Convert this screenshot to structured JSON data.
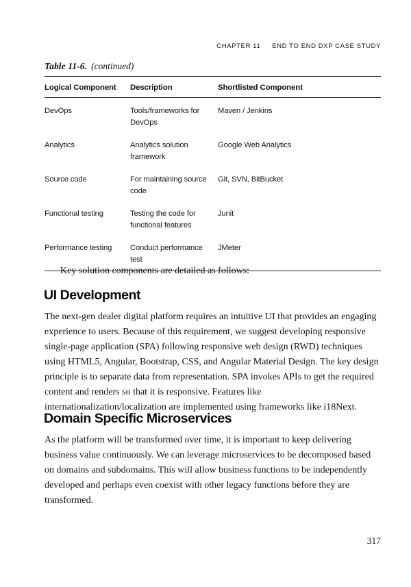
{
  "running_head": {
    "chapter": "CHAPTER 11",
    "title": "END TO END DXP CASE STUDY"
  },
  "table": {
    "caption_number": "Table 11-6.",
    "caption_note": "(continued)",
    "columns": [
      "Logical Component",
      "Description",
      "Shortlisted Component"
    ],
    "rows": [
      {
        "logical_component": "DevOps",
        "description": "Tools/frameworks for DevOps",
        "shortlisted_component": "Maven / Jenkins"
      },
      {
        "logical_component": "Analytics",
        "description": "Analytics solution framework",
        "shortlisted_component": "Google Web Analytics"
      },
      {
        "logical_component": "Source code",
        "description": "For maintaining source code",
        "shortlisted_component": "Git, SVN, BitBucket"
      },
      {
        "logical_component": "Functional testing",
        "description": "Testing the code for functional features",
        "shortlisted_component": "Junit"
      },
      {
        "logical_component": "Performance testing",
        "description": "Conduct performance test",
        "shortlisted_component": "JMeter"
      }
    ]
  },
  "content": {
    "lead_paragraph": "Key solution components are detailed as follows:",
    "section_ui_heading": "UI Development",
    "section_ui_body": "The next-gen dealer digital platform requires an intuitive UI that provides an engaging experience to users. Because of this requirement, we suggest developing responsive single-page application (SPA) following responsive web design (RWD) techniques using HTML5, Angular, Bootstrap, CSS, and Angular Material Design. The key design principle is to separate data from representation. SPA invokes APIs to get the required content and renders so that it is responsive. Features like internationalization/localization are implemented using frameworks like i18Next.",
    "section_microservices_heading": "Domain Specific Microservices",
    "section_microservices_body": "As the platform will be transformed over time, it is important to keep delivering business value continuously. We can leverage microservices to be decomposed based on domains and subdomains. This will allow business functions to be independently developed and perhaps even coexist with other legacy functions before they are transformed."
  },
  "folio": {
    "page_number": "317"
  }
}
